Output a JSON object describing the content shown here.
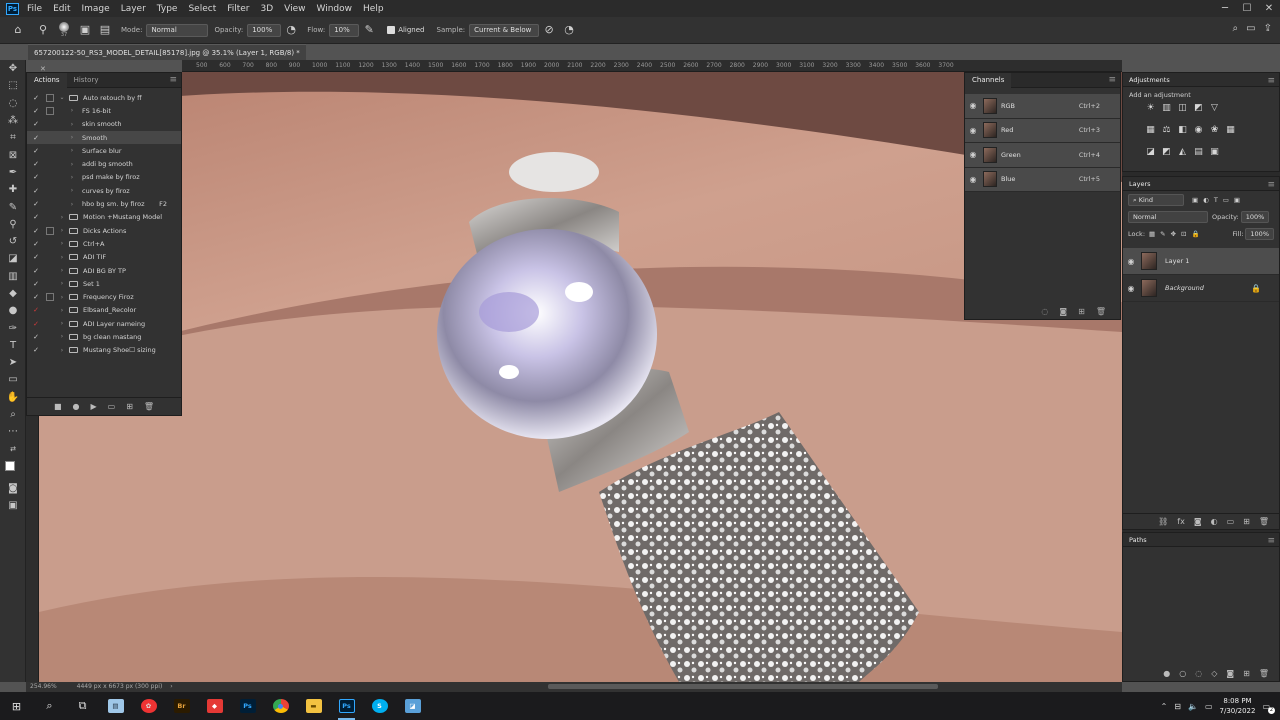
{
  "menubar": {
    "logo": "Ps",
    "items": [
      "File",
      "Edit",
      "Image",
      "Layer",
      "Type",
      "Select",
      "Filter",
      "3D",
      "View",
      "Window",
      "Help"
    ]
  },
  "options": {
    "brush_size": "37",
    "mode_label": "Mode:",
    "mode_value": "Normal",
    "opacity_label": "Opacity:",
    "opacity_value": "100%",
    "flow_label": "Flow:",
    "flow_value": "10%",
    "aligned_label": "Aligned",
    "sample_label": "Sample:",
    "sample_value": "Current & Below"
  },
  "document": {
    "tab_title": "657200122-50_RS3_MODEL_DETAIL[85178].jpg @ 35.1% (Layer 1, RGB/8) *"
  },
  "ruler": {
    "ticks": [
      "500",
      "600",
      "700",
      "800",
      "900",
      "1000",
      "1100",
      "1200",
      "1300",
      "1400",
      "1500",
      "1600",
      "1700",
      "1800",
      "1900",
      "2000",
      "2100",
      "2200",
      "2300",
      "2400",
      "2500",
      "2600",
      "2700",
      "2800",
      "2900",
      "3000",
      "3100",
      "3200",
      "3300",
      "3400",
      "3500",
      "3600",
      "3700"
    ]
  },
  "actions_panel": {
    "tab_actions": "Actions",
    "tab_history": "History",
    "rows": [
      {
        "label": "Auto retouch by ff",
        "check": "✓",
        "red": false,
        "dialog": "☐",
        "twisty": "⌄",
        "folder": true,
        "indent": 0,
        "selected": false,
        "shortcut": ""
      },
      {
        "label": "FS 16-bit",
        "check": "✓",
        "red": false,
        "dialog": "☐",
        "twisty": "›",
        "folder": false,
        "indent": 1,
        "selected": false,
        "shortcut": ""
      },
      {
        "label": "skin smooth",
        "check": "✓",
        "red": false,
        "dialog": "",
        "twisty": "›",
        "folder": false,
        "indent": 1,
        "selected": false,
        "shortcut": ""
      },
      {
        "label": "Smooth",
        "check": "✓",
        "red": false,
        "dialog": "",
        "twisty": "›",
        "folder": false,
        "indent": 1,
        "selected": true,
        "shortcut": ""
      },
      {
        "label": "Surface blur",
        "check": "✓",
        "red": false,
        "dialog": "",
        "twisty": "›",
        "folder": false,
        "indent": 1,
        "selected": false,
        "shortcut": ""
      },
      {
        "label": "addi bg smooth",
        "check": "✓",
        "red": false,
        "dialog": "",
        "twisty": "›",
        "folder": false,
        "indent": 1,
        "selected": false,
        "shortcut": ""
      },
      {
        "label": "psd make by firoz",
        "check": "✓",
        "red": false,
        "dialog": "",
        "twisty": "›",
        "folder": false,
        "indent": 1,
        "selected": false,
        "shortcut": ""
      },
      {
        "label": "curves by firoz",
        "check": "✓",
        "red": false,
        "dialog": "",
        "twisty": "›",
        "folder": false,
        "indent": 1,
        "selected": false,
        "shortcut": ""
      },
      {
        "label": "hbo bg sm. by firoz",
        "check": "✓",
        "red": false,
        "dialog": "",
        "twisty": "›",
        "folder": false,
        "indent": 1,
        "selected": false,
        "shortcut": "F2"
      },
      {
        "label": "Motion +Mustang Model",
        "check": "✓",
        "red": false,
        "dialog": "",
        "twisty": "›",
        "folder": true,
        "indent": 0,
        "selected": false,
        "shortcut": ""
      },
      {
        "label": "Dicks Actions",
        "check": "✓",
        "red": false,
        "dialog": "☐",
        "twisty": "›",
        "folder": true,
        "indent": 0,
        "selected": false,
        "shortcut": ""
      },
      {
        "label": "Ctrl+A",
        "check": "✓",
        "red": false,
        "dialog": "",
        "twisty": "›",
        "folder": true,
        "indent": 0,
        "selected": false,
        "shortcut": ""
      },
      {
        "label": "ADI TIF",
        "check": "✓",
        "red": false,
        "dialog": "",
        "twisty": "›",
        "folder": true,
        "indent": 0,
        "selected": false,
        "shortcut": ""
      },
      {
        "label": "ADI BG BY TP",
        "check": "✓",
        "red": false,
        "dialog": "",
        "twisty": "›",
        "folder": true,
        "indent": 0,
        "selected": false,
        "shortcut": ""
      },
      {
        "label": "Set 1",
        "check": "✓",
        "red": false,
        "dialog": "",
        "twisty": "›",
        "folder": true,
        "indent": 0,
        "selected": false,
        "shortcut": ""
      },
      {
        "label": "Frequency Firoz",
        "check": "✓",
        "red": false,
        "dialog": "☐",
        "twisty": "›",
        "folder": true,
        "indent": 0,
        "selected": false,
        "shortcut": ""
      },
      {
        "label": "Elbsand_Recolor",
        "check": "✓",
        "red": true,
        "dialog": "",
        "twisty": "›",
        "folder": true,
        "indent": 0,
        "selected": false,
        "shortcut": ""
      },
      {
        "label": "ADI Layer nameing",
        "check": "✓",
        "red": true,
        "dialog": "",
        "twisty": "›",
        "folder": true,
        "indent": 0,
        "selected": false,
        "shortcut": ""
      },
      {
        "label": "bg clean mastang",
        "check": "✓",
        "red": false,
        "dialog": "",
        "twisty": "›",
        "folder": true,
        "indent": 0,
        "selected": false,
        "shortcut": ""
      },
      {
        "label": "Mustang Shoe☐ sizing",
        "check": "✓",
        "red": false,
        "dialog": "",
        "twisty": "›",
        "folder": true,
        "indent": 0,
        "selected": false,
        "shortcut": ""
      }
    ]
  },
  "channels_panel": {
    "title": "Channels",
    "rows": [
      {
        "name": "RGB",
        "shortcut": "Ctrl+2"
      },
      {
        "name": "Red",
        "shortcut": "Ctrl+3"
      },
      {
        "name": "Green",
        "shortcut": "Ctrl+4"
      },
      {
        "name": "Blue",
        "shortcut": "Ctrl+5"
      }
    ]
  },
  "adjustments_panel": {
    "title": "Adjustments",
    "hint": "Add an adjustment"
  },
  "layers_panel": {
    "title": "Layers",
    "filter_kind": "Kind",
    "blend_mode": "Normal",
    "opacity_label": "Opacity:",
    "opacity_value": "100%",
    "lock_label": "Lock:",
    "fill_label": "Fill:",
    "fill_value": "100%",
    "layers": [
      {
        "name": "Layer 1",
        "selected": true,
        "locked": false
      },
      {
        "name": "Background",
        "selected": false,
        "locked": true
      }
    ]
  },
  "paths_panel": {
    "title": "Paths"
  },
  "status": {
    "zoom": "254.96%",
    "doc_info": "4449 px x 6673 px (300 ppi)"
  },
  "taskbar": {
    "time": "8:08 PM",
    "date": "7/30/2022",
    "notif_count": "2"
  },
  "colors": {
    "accent": "#31a8ff",
    "panel_bg": "#323232",
    "canvas_bg": "#535353"
  }
}
